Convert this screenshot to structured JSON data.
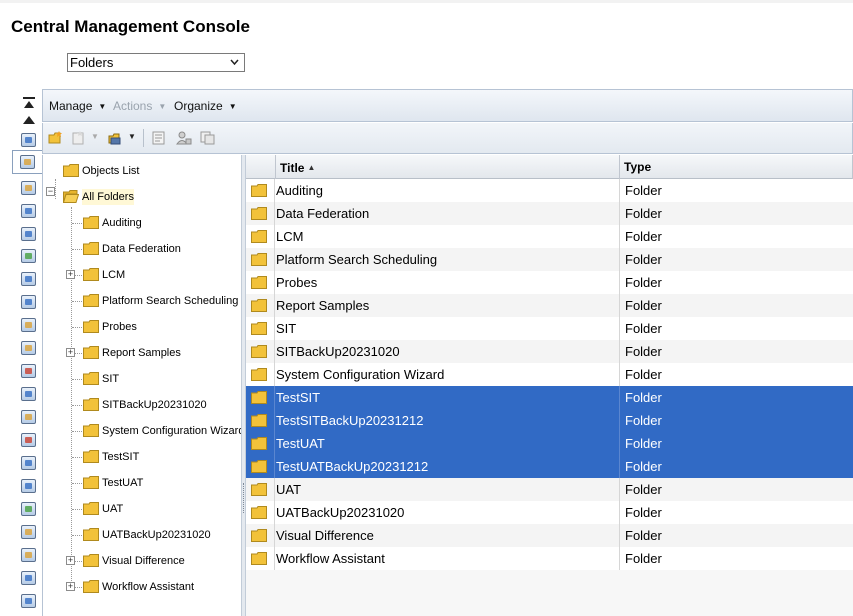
{
  "app": {
    "title": "Central Management Console"
  },
  "view_select": {
    "value": "Folders"
  },
  "menubar": {
    "manage": "Manage",
    "actions": "Actions",
    "organize": "Organize"
  },
  "tree": {
    "objects_list": "Objects List",
    "all_folders": "All Folders",
    "items": [
      {
        "label": "Auditing",
        "expandable": false
      },
      {
        "label": "Data Federation",
        "expandable": false
      },
      {
        "label": "LCM",
        "expandable": true
      },
      {
        "label": "Platform Search Scheduling",
        "expandable": false
      },
      {
        "label": "Probes",
        "expandable": false
      },
      {
        "label": "Report Samples",
        "expandable": true
      },
      {
        "label": "SIT",
        "expandable": false
      },
      {
        "label": "SITBackUp20231020",
        "expandable": false
      },
      {
        "label": "System Configuration Wizard",
        "expandable": false
      },
      {
        "label": "TestSIT",
        "expandable": false
      },
      {
        "label": "TestUAT",
        "expandable": false
      },
      {
        "label": "UAT",
        "expandable": false
      },
      {
        "label": "UATBackUp20231020",
        "expandable": false
      },
      {
        "label": "Visual Difference",
        "expandable": true
      },
      {
        "label": "Workflow Assistant",
        "expandable": true
      }
    ]
  },
  "grid": {
    "headers": {
      "title": "Title",
      "type": "Type"
    },
    "rows": [
      {
        "title": "Auditing",
        "type": "Folder",
        "selected": false
      },
      {
        "title": "Data Federation",
        "type": "Folder",
        "selected": false
      },
      {
        "title": "LCM",
        "type": "Folder",
        "selected": false
      },
      {
        "title": "Platform Search Scheduling",
        "type": "Folder",
        "selected": false
      },
      {
        "title": "Probes",
        "type": "Folder",
        "selected": false
      },
      {
        "title": "Report Samples",
        "type": "Folder",
        "selected": false
      },
      {
        "title": "SIT",
        "type": "Folder",
        "selected": false
      },
      {
        "title": "SITBackUp20231020",
        "type": "Folder",
        "selected": false
      },
      {
        "title": "System Configuration Wizard",
        "type": "Folder",
        "selected": false
      },
      {
        "title": "TestSIT",
        "type": "Folder",
        "selected": true
      },
      {
        "title": "TestSITBackUp20231212",
        "type": "Folder",
        "selected": true
      },
      {
        "title": "TestUAT",
        "type": "Folder",
        "selected": true
      },
      {
        "title": "TestUATBackUp20231212",
        "type": "Folder",
        "selected": true
      },
      {
        "title": "UAT",
        "type": "Folder",
        "selected": false
      },
      {
        "title": "UATBackUp20231020",
        "type": "Folder",
        "selected": false
      },
      {
        "title": "Visual Difference",
        "type": "Folder",
        "selected": false
      },
      {
        "title": "Workflow Assistant",
        "type": "Folder",
        "selected": false
      }
    ]
  },
  "colors": {
    "selection": "#316ac5",
    "folder": "#f2c23a",
    "toolbar": "#dfe6ef"
  },
  "icons": {
    "toolbar": [
      "new-folder-icon",
      "new-object-icon",
      "organize-icon",
      "properties-icon",
      "user-security-icon",
      "copy-icon"
    ],
    "sidebar": [
      "collapse-icon",
      "folders-tab-icon",
      "personal-folders-icon",
      "categories-icon",
      "inbox-icon",
      "users-groups-icon",
      "servers-icon",
      "server-groups-icon",
      "connections-icon",
      "universes-icon",
      "access-levels-icon",
      "calendars-icon",
      "events-icon",
      "sessions-icon",
      "instances-icon",
      "applications-icon",
      "auditing-icon",
      "authentication-icon",
      "licenses-icon",
      "settings-icon",
      "federation-icon"
    ]
  }
}
